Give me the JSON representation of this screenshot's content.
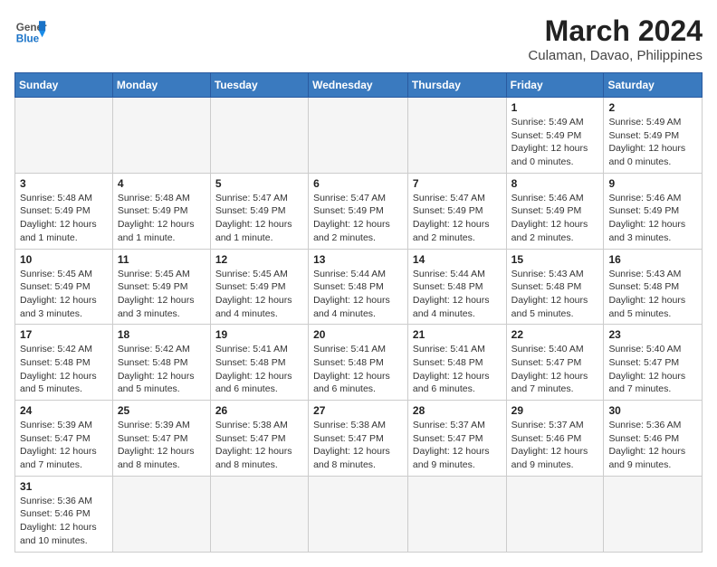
{
  "header": {
    "logo_general": "General",
    "logo_blue": "Blue",
    "month_year": "March 2024",
    "location": "Culaman, Davao, Philippines"
  },
  "weekdays": [
    "Sunday",
    "Monday",
    "Tuesday",
    "Wednesday",
    "Thursday",
    "Friday",
    "Saturday"
  ],
  "days": [
    {
      "date": "",
      "info": ""
    },
    {
      "date": "",
      "info": ""
    },
    {
      "date": "",
      "info": ""
    },
    {
      "date": "",
      "info": ""
    },
    {
      "date": "",
      "info": ""
    },
    {
      "date": "1",
      "info": "Sunrise: 5:49 AM\nSunset: 5:49 PM\nDaylight: 12 hours and 0 minutes."
    },
    {
      "date": "2",
      "info": "Sunrise: 5:49 AM\nSunset: 5:49 PM\nDaylight: 12 hours and 0 minutes."
    },
    {
      "date": "3",
      "info": "Sunrise: 5:48 AM\nSunset: 5:49 PM\nDaylight: 12 hours and 1 minute."
    },
    {
      "date": "4",
      "info": "Sunrise: 5:48 AM\nSunset: 5:49 PM\nDaylight: 12 hours and 1 minute."
    },
    {
      "date": "5",
      "info": "Sunrise: 5:47 AM\nSunset: 5:49 PM\nDaylight: 12 hours and 1 minute."
    },
    {
      "date": "6",
      "info": "Sunrise: 5:47 AM\nSunset: 5:49 PM\nDaylight: 12 hours and 2 minutes."
    },
    {
      "date": "7",
      "info": "Sunrise: 5:47 AM\nSunset: 5:49 PM\nDaylight: 12 hours and 2 minutes."
    },
    {
      "date": "8",
      "info": "Sunrise: 5:46 AM\nSunset: 5:49 PM\nDaylight: 12 hours and 2 minutes."
    },
    {
      "date": "9",
      "info": "Sunrise: 5:46 AM\nSunset: 5:49 PM\nDaylight: 12 hours and 3 minutes."
    },
    {
      "date": "10",
      "info": "Sunrise: 5:45 AM\nSunset: 5:49 PM\nDaylight: 12 hours and 3 minutes."
    },
    {
      "date": "11",
      "info": "Sunrise: 5:45 AM\nSunset: 5:49 PM\nDaylight: 12 hours and 3 minutes."
    },
    {
      "date": "12",
      "info": "Sunrise: 5:45 AM\nSunset: 5:49 PM\nDaylight: 12 hours and 4 minutes."
    },
    {
      "date": "13",
      "info": "Sunrise: 5:44 AM\nSunset: 5:48 PM\nDaylight: 12 hours and 4 minutes."
    },
    {
      "date": "14",
      "info": "Sunrise: 5:44 AM\nSunset: 5:48 PM\nDaylight: 12 hours and 4 minutes."
    },
    {
      "date": "15",
      "info": "Sunrise: 5:43 AM\nSunset: 5:48 PM\nDaylight: 12 hours and 5 minutes."
    },
    {
      "date": "16",
      "info": "Sunrise: 5:43 AM\nSunset: 5:48 PM\nDaylight: 12 hours and 5 minutes."
    },
    {
      "date": "17",
      "info": "Sunrise: 5:42 AM\nSunset: 5:48 PM\nDaylight: 12 hours and 5 minutes."
    },
    {
      "date": "18",
      "info": "Sunrise: 5:42 AM\nSunset: 5:48 PM\nDaylight: 12 hours and 5 minutes."
    },
    {
      "date": "19",
      "info": "Sunrise: 5:41 AM\nSunset: 5:48 PM\nDaylight: 12 hours and 6 minutes."
    },
    {
      "date": "20",
      "info": "Sunrise: 5:41 AM\nSunset: 5:48 PM\nDaylight: 12 hours and 6 minutes."
    },
    {
      "date": "21",
      "info": "Sunrise: 5:41 AM\nSunset: 5:48 PM\nDaylight: 12 hours and 6 minutes."
    },
    {
      "date": "22",
      "info": "Sunrise: 5:40 AM\nSunset: 5:47 PM\nDaylight: 12 hours and 7 minutes."
    },
    {
      "date": "23",
      "info": "Sunrise: 5:40 AM\nSunset: 5:47 PM\nDaylight: 12 hours and 7 minutes."
    },
    {
      "date": "24",
      "info": "Sunrise: 5:39 AM\nSunset: 5:47 PM\nDaylight: 12 hours and 7 minutes."
    },
    {
      "date": "25",
      "info": "Sunrise: 5:39 AM\nSunset: 5:47 PM\nDaylight: 12 hours and 8 minutes."
    },
    {
      "date": "26",
      "info": "Sunrise: 5:38 AM\nSunset: 5:47 PM\nDaylight: 12 hours and 8 minutes."
    },
    {
      "date": "27",
      "info": "Sunrise: 5:38 AM\nSunset: 5:47 PM\nDaylight: 12 hours and 8 minutes."
    },
    {
      "date": "28",
      "info": "Sunrise: 5:37 AM\nSunset: 5:47 PM\nDaylight: 12 hours and 9 minutes."
    },
    {
      "date": "29",
      "info": "Sunrise: 5:37 AM\nSunset: 5:46 PM\nDaylight: 12 hours and 9 minutes."
    },
    {
      "date": "30",
      "info": "Sunrise: 5:36 AM\nSunset: 5:46 PM\nDaylight: 12 hours and 9 minutes."
    },
    {
      "date": "31",
      "info": "Sunrise: 5:36 AM\nSunset: 5:46 PM\nDaylight: 12 hours and 10 minutes."
    },
    {
      "date": "",
      "info": ""
    },
    {
      "date": "",
      "info": ""
    },
    {
      "date": "",
      "info": ""
    },
    {
      "date": "",
      "info": ""
    },
    {
      "date": "",
      "info": ""
    },
    {
      "date": "",
      "info": ""
    }
  ]
}
